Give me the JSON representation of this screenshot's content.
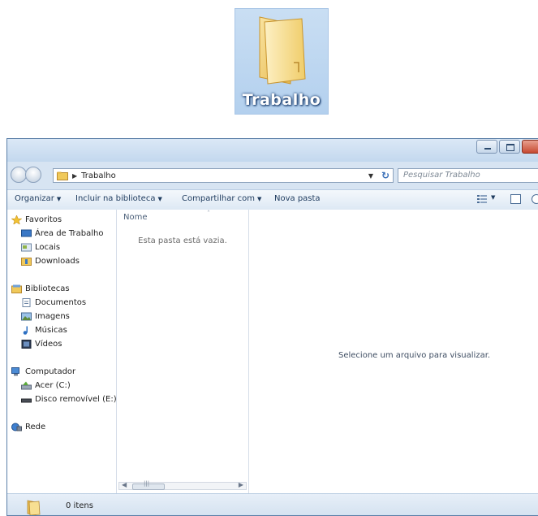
{
  "desktop_icon": {
    "label": "Trabalho"
  },
  "window": {
    "address": {
      "path": "Trabalho"
    },
    "search": {
      "placeholder": "Pesquisar Trabalho"
    },
    "toolbar": {
      "organize": "Organizar",
      "include_library": "Incluir na biblioteca",
      "share_with": "Compartilhar com",
      "new_folder": "Nova pasta"
    },
    "nav": {
      "favorites": "Favoritos",
      "desktop": "Área de Trabalho",
      "places": "Locais",
      "downloads": "Downloads",
      "libraries": "Bibliotecas",
      "documents": "Documentos",
      "images": "Imagens",
      "music": "Músicas",
      "videos": "Vídeos",
      "computer": "Computador",
      "drive_c": "Acer (C:)",
      "drive_e": "Disco removível (E:)",
      "network": "Rede"
    },
    "list": {
      "column_name": "Nome",
      "empty_message": "Esta pasta está vazia."
    },
    "preview": {
      "message": "Selecione um arquivo para visualizar."
    },
    "status": {
      "items": "0 itens"
    }
  },
  "colors": {
    "folder": "#f2c94c",
    "title_bar": "#c3d8ee",
    "close_button": "#c74a32"
  }
}
